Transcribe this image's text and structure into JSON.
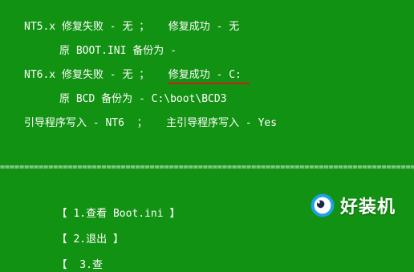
{
  "lines": [
    "NT5.x 修复失败 - 无 ；   修复成功 - 无",
    "原 BOOT.INI 备份为 -",
    "NT6.x 修复失败 - 无 ；   修复成功 - C:",
    "原 BCD 备份为 - C:\\boot\\BCD3",
    "引导程序写入 - NT6  ；   主引导程序写入 - Yes"
  ],
  "separator_text": "=============================================================================================",
  "menu": {
    "item1": "【 1.查看 Boot.ini 】",
    "item2": "【 2.退出 】",
    "item3": "【  3.查"
  },
  "watermark": {
    "text": "好装机"
  },
  "colors": {
    "background": "#129212",
    "text": "#ffffff",
    "underline": "#c81e1e"
  }
}
